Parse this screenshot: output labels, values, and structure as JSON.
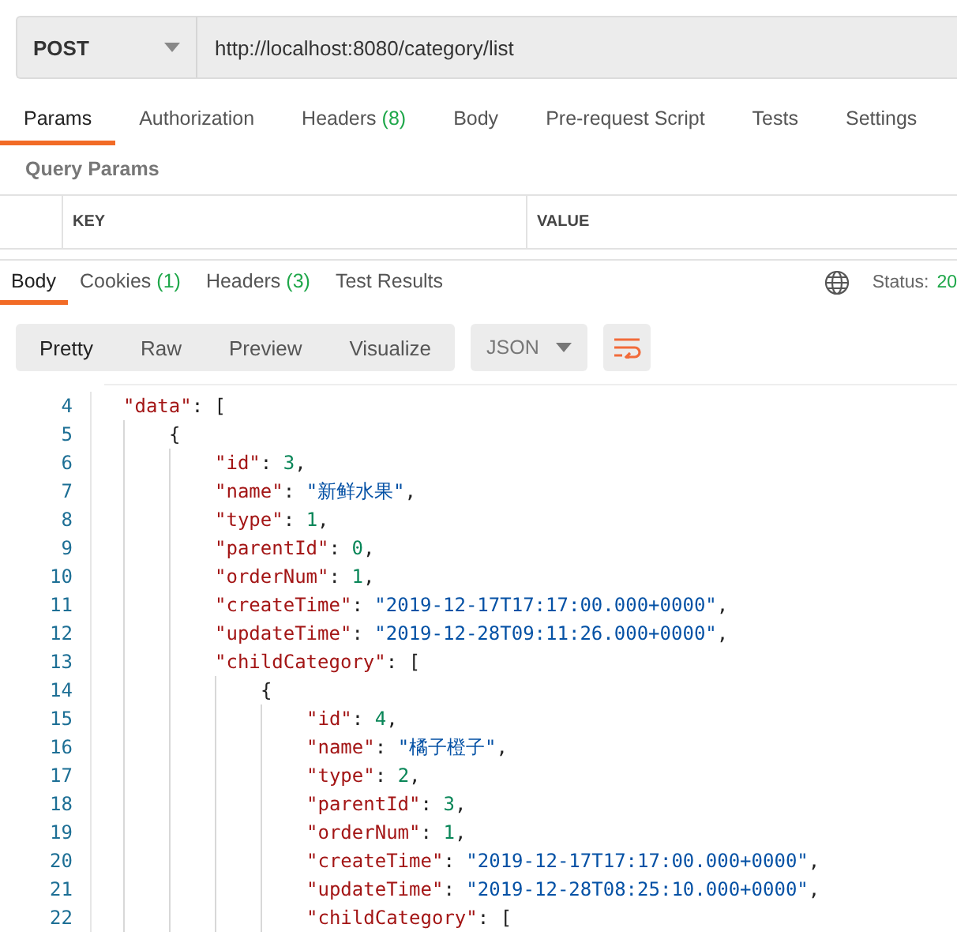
{
  "request": {
    "method": "POST",
    "url": "http://localhost:8080/category/list"
  },
  "request_tabs": [
    {
      "label": "Params",
      "selected": true
    },
    {
      "label": "Authorization",
      "selected": false
    },
    {
      "label": "Headers",
      "count": "(8)",
      "selected": false
    },
    {
      "label": "Body",
      "selected": false
    },
    {
      "label": "Pre-request Script",
      "selected": false
    },
    {
      "label": "Tests",
      "selected": false
    },
    {
      "label": "Settings",
      "selected": false
    }
  ],
  "query_params": {
    "title": "Query Params",
    "columns": [
      "KEY",
      "VALUE"
    ]
  },
  "response_tabs": [
    {
      "label": "Body",
      "selected": true
    },
    {
      "label": "Cookies",
      "count": "(1)",
      "selected": false
    },
    {
      "label": "Headers",
      "count": "(3)",
      "selected": false
    },
    {
      "label": "Test Results",
      "selected": false
    }
  ],
  "status": {
    "label": "Status:",
    "value": "20"
  },
  "view_modes": [
    {
      "label": "Pretty",
      "selected": true
    },
    {
      "label": "Raw",
      "selected": false
    },
    {
      "label": "Preview",
      "selected": false
    },
    {
      "label": "Visualize",
      "selected": false
    }
  ],
  "format": "JSON",
  "code_lines": [
    {
      "n": "4",
      "tokens": [
        {
          "kind": "key",
          "text": "\"data\""
        },
        {
          "kind": "punct",
          "text": ": ["
        }
      ],
      "children": [
        {
          "n": "5",
          "tokens": [
            {
              "kind": "punct",
              "text": "{"
            }
          ],
          "children": [
            {
              "n": "6",
              "tokens": [
                {
                  "kind": "key",
                  "text": "\"id\""
                },
                {
                  "kind": "punct",
                  "text": ": "
                },
                {
                  "kind": "number",
                  "text": "3"
                },
                {
                  "kind": "punct",
                  "text": ","
                }
              ]
            },
            {
              "n": "7",
              "tokens": [
                {
                  "kind": "key",
                  "text": "\"name\""
                },
                {
                  "kind": "punct",
                  "text": ": "
                },
                {
                  "kind": "string",
                  "text": "\"新鲜水果\""
                },
                {
                  "kind": "punct",
                  "text": ","
                }
              ]
            },
            {
              "n": "8",
              "tokens": [
                {
                  "kind": "key",
                  "text": "\"type\""
                },
                {
                  "kind": "punct",
                  "text": ": "
                },
                {
                  "kind": "number",
                  "text": "1"
                },
                {
                  "kind": "punct",
                  "text": ","
                }
              ]
            },
            {
              "n": "9",
              "tokens": [
                {
                  "kind": "key",
                  "text": "\"parentId\""
                },
                {
                  "kind": "punct",
                  "text": ": "
                },
                {
                  "kind": "number",
                  "text": "0"
                },
                {
                  "kind": "punct",
                  "text": ","
                }
              ]
            },
            {
              "n": "10",
              "tokens": [
                {
                  "kind": "key",
                  "text": "\"orderNum\""
                },
                {
                  "kind": "punct",
                  "text": ": "
                },
                {
                  "kind": "number",
                  "text": "1"
                },
                {
                  "kind": "punct",
                  "text": ","
                }
              ]
            },
            {
              "n": "11",
              "tokens": [
                {
                  "kind": "key",
                  "text": "\"createTime\""
                },
                {
                  "kind": "punct",
                  "text": ": "
                },
                {
                  "kind": "string",
                  "text": "\"2019-12-17T17:17:00.000+0000\""
                },
                {
                  "kind": "punct",
                  "text": ","
                }
              ]
            },
            {
              "n": "12",
              "tokens": [
                {
                  "kind": "key",
                  "text": "\"updateTime\""
                },
                {
                  "kind": "punct",
                  "text": ": "
                },
                {
                  "kind": "string",
                  "text": "\"2019-12-28T09:11:26.000+0000\""
                },
                {
                  "kind": "punct",
                  "text": ","
                }
              ]
            },
            {
              "n": "13",
              "tokens": [
                {
                  "kind": "key",
                  "text": "\"childCategory\""
                },
                {
                  "kind": "punct",
                  "text": ": ["
                }
              ],
              "children": [
                {
                  "n": "14",
                  "tokens": [
                    {
                      "kind": "punct",
                      "text": "{"
                    }
                  ],
                  "children": [
                    {
                      "n": "15",
                      "tokens": [
                        {
                          "kind": "key",
                          "text": "\"id\""
                        },
                        {
                          "kind": "punct",
                          "text": ": "
                        },
                        {
                          "kind": "number",
                          "text": "4"
                        },
                        {
                          "kind": "punct",
                          "text": ","
                        }
                      ]
                    },
                    {
                      "n": "16",
                      "tokens": [
                        {
                          "kind": "key",
                          "text": "\"name\""
                        },
                        {
                          "kind": "punct",
                          "text": ": "
                        },
                        {
                          "kind": "string",
                          "text": "\"橘子橙子\""
                        },
                        {
                          "kind": "punct",
                          "text": ","
                        }
                      ]
                    },
                    {
                      "n": "17",
                      "tokens": [
                        {
                          "kind": "key",
                          "text": "\"type\""
                        },
                        {
                          "kind": "punct",
                          "text": ": "
                        },
                        {
                          "kind": "number",
                          "text": "2"
                        },
                        {
                          "kind": "punct",
                          "text": ","
                        }
                      ]
                    },
                    {
                      "n": "18",
                      "tokens": [
                        {
                          "kind": "key",
                          "text": "\"parentId\""
                        },
                        {
                          "kind": "punct",
                          "text": ": "
                        },
                        {
                          "kind": "number",
                          "text": "3"
                        },
                        {
                          "kind": "punct",
                          "text": ","
                        }
                      ]
                    },
                    {
                      "n": "19",
                      "tokens": [
                        {
                          "kind": "key",
                          "text": "\"orderNum\""
                        },
                        {
                          "kind": "punct",
                          "text": ": "
                        },
                        {
                          "kind": "number",
                          "text": "1"
                        },
                        {
                          "kind": "punct",
                          "text": ","
                        }
                      ]
                    },
                    {
                      "n": "20",
                      "tokens": [
                        {
                          "kind": "key",
                          "text": "\"createTime\""
                        },
                        {
                          "kind": "punct",
                          "text": ": "
                        },
                        {
                          "kind": "string",
                          "text": "\"2019-12-17T17:17:00.000+0000\""
                        },
                        {
                          "kind": "punct",
                          "text": ","
                        }
                      ]
                    },
                    {
                      "n": "21",
                      "tokens": [
                        {
                          "kind": "key",
                          "text": "\"updateTime\""
                        },
                        {
                          "kind": "punct",
                          "text": ": "
                        },
                        {
                          "kind": "string",
                          "text": "\"2019-12-28T08:25:10.000+0000\""
                        },
                        {
                          "kind": "punct",
                          "text": ","
                        }
                      ]
                    },
                    {
                      "n": "22",
                      "tokens": [
                        {
                          "kind": "key",
                          "text": "\"childCategory\""
                        },
                        {
                          "kind": "punct",
                          "text": ": ["
                        }
                      ]
                    }
                  ]
                }
              ]
            }
          ]
        }
      ]
    }
  ]
}
